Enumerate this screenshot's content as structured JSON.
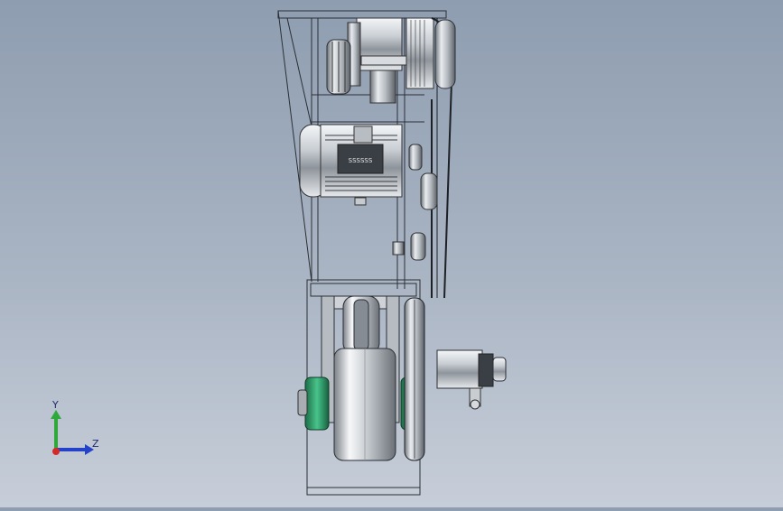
{
  "viewport": {
    "background_top": "#8e9db0",
    "background_bottom": "#c7ced9"
  },
  "motor_plate": {
    "text": "SSSSSS"
  },
  "triad": {
    "y_label": "Y",
    "z_label": "Z",
    "y_color": "#2faa3a",
    "z_color": "#2442c9",
    "x_color": "#d42a2a"
  }
}
